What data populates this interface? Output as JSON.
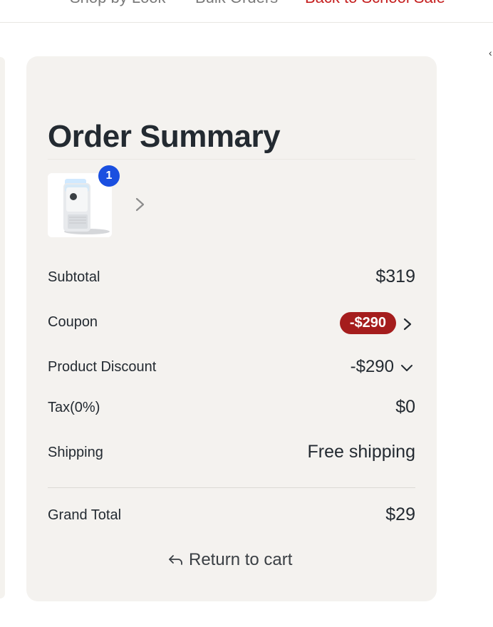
{
  "topnav": {
    "items": [
      {
        "label": "Shop by Look",
        "color": "#7a7a7a"
      },
      {
        "label": "Bulk Orders",
        "color": "#7a7a7a"
      },
      {
        "label": "Back to School Sale",
        "color": "#c51f1f"
      }
    ]
  },
  "summary": {
    "title": "Order Summary",
    "product": {
      "image_icon": "air-purifier-image",
      "quantity": "1"
    },
    "rows": {
      "subtotal": {
        "label": "Subtotal",
        "value": "$319"
      },
      "coupon": {
        "label": "Coupon",
        "value": "-$290"
      },
      "discount": {
        "label": "Product Discount",
        "value": "-$290"
      },
      "tax": {
        "label": "Tax(0%)",
        "value": "$0"
      },
      "shipping": {
        "label": "Shipping",
        "value": "Free shipping"
      },
      "grand_total": {
        "label": "Grand Total",
        "value": "$29"
      }
    },
    "return_link": "Return to cart"
  },
  "colors": {
    "card_bg": "#f4f2ef",
    "coupon_pill": "#a51d1d",
    "badge": "#1a4fe0",
    "text": "#232a31",
    "sale_text": "#c51f1f"
  }
}
